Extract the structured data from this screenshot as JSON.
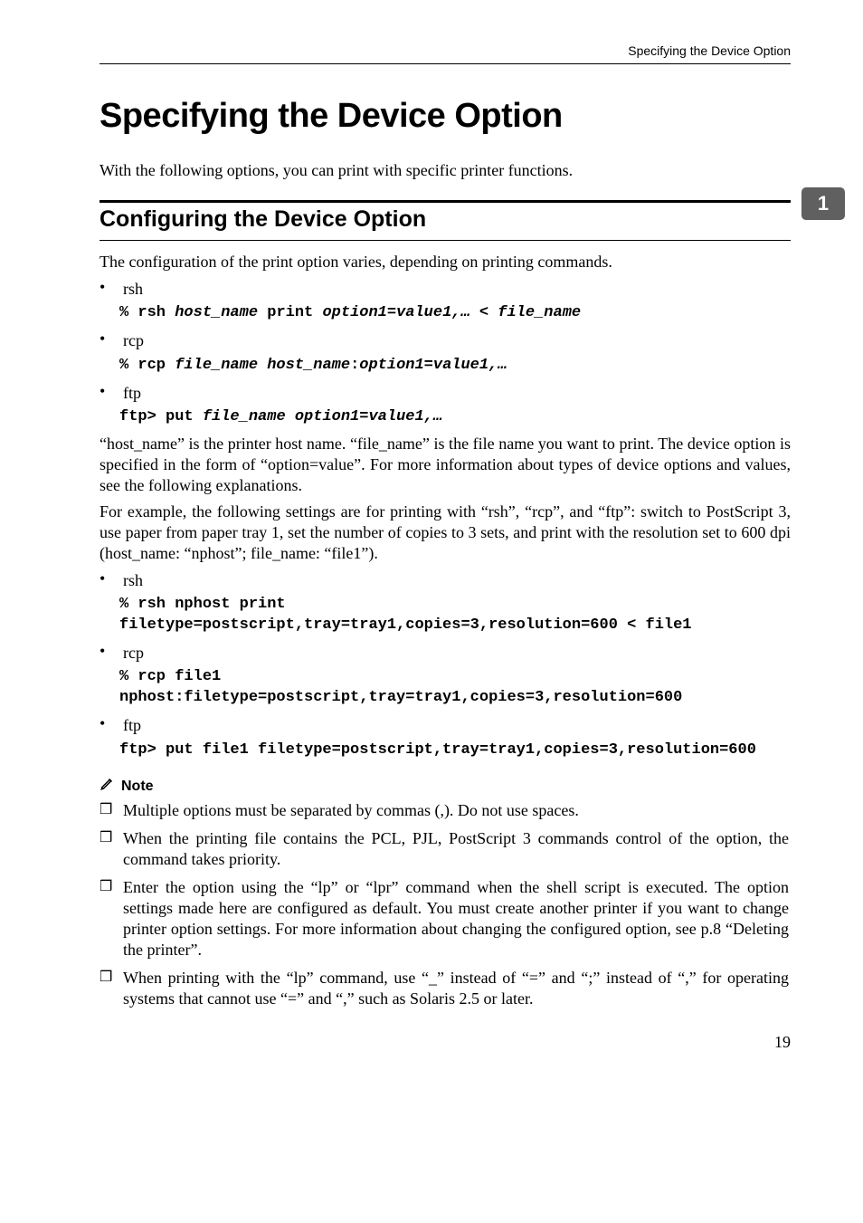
{
  "running_head": "Specifying the Device Option",
  "chapter_tab": "1",
  "chapter_title": "Specifying the Device Option",
  "intro": "With the following options, you can print with specific printer functions.",
  "section_title": "Configuring the Device Option",
  "section_intro": "The configuration of the print option varies, depending on printing commands.",
  "commands1": [
    {
      "label": "rsh",
      "prefix": "% rsh ",
      "args": "host_name",
      "mid": " print ",
      "args2": "option1=value1,… < file_name"
    },
    {
      "label": "rcp",
      "prefix": "% rcp ",
      "args": "file_name host_name",
      "mid": ":",
      "args2": "option1=value1,…"
    },
    {
      "label": "ftp",
      "prefix": "ftp> put ",
      "args": "file_name option1=value1,…",
      "mid": "",
      "args2": ""
    }
  ],
  "para_hostname": "“host_name” is the printer host name. “file_name” is the file name you want to print. The device option is specified in the form of “option=value”. For more information about types of device options and values, see the following explanations.",
  "para_example": "For example, the following settings are for printing with “rsh”, “rcp”, and “ftp”: switch to PostScript 3, use paper from paper tray 1, set the number of copies to 3 sets, and print with the resolution set to 600 dpi (host_name: “nphost”; file_name: “file1”).",
  "commands2": [
    {
      "label": "rsh",
      "cmd": "% rsh nphost print filetype=postscript,tray=tray1,copies=3,resolution=600 < file1"
    },
    {
      "label": "rcp",
      "cmd": "% rcp file1 nphost:filetype=postscript,tray=tray1,copies=3,resolution=600"
    },
    {
      "label": "ftp",
      "cmd": "ftp> put file1 filetype=postscript,tray=tray1,copies=3,resolution=600"
    }
  ],
  "note_label": "Note",
  "notes": [
    "Multiple options must be separated by commas (,). Do not use spaces.",
    "When the printing file contains the PCL, PJL, PostScript 3 commands control of the option, the command takes priority.",
    "Enter the option using the “lp” or “lpr” command when the shell script is executed. The option settings made here are configured as default. You must create another printer if you want to change printer option settings. For more information about changing the configured option, see p.8 “Deleting the printer”.",
    "When printing with the “lp” command, use “_” instead of “=” and “;” instead of “,” for operating systems that cannot use “=” and “,” such as Solaris 2.5 or later."
  ],
  "page_number": "19"
}
